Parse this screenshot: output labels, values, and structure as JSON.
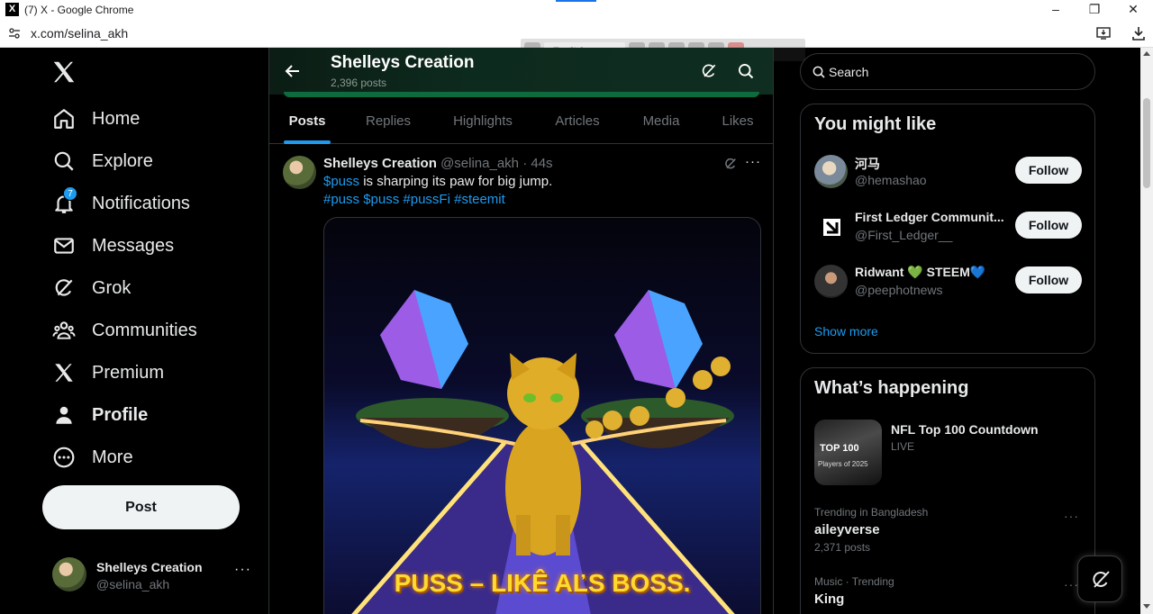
{
  "browser": {
    "window_title": "(7) X - Google Chrome",
    "favicon_letter": "X",
    "url": "x.com/selina_akh",
    "minimize_label": "–",
    "maximize_label": "❐",
    "close_label": "✕"
  },
  "translate_bar": {
    "language": "English"
  },
  "nav": {
    "items": [
      {
        "label": "Home",
        "icon": "home-icon"
      },
      {
        "label": "Explore",
        "icon": "search-icon"
      },
      {
        "label": "Notifications",
        "icon": "bell-icon",
        "badge": "7"
      },
      {
        "label": "Messages",
        "icon": "mail-icon"
      },
      {
        "label": "Grok",
        "icon": "grok-icon"
      },
      {
        "label": "Communities",
        "icon": "people-icon"
      },
      {
        "label": "Premium",
        "icon": "x-logo-icon"
      },
      {
        "label": "Profile",
        "icon": "person-icon"
      },
      {
        "label": "More",
        "icon": "more-circle-icon"
      }
    ],
    "post_button": "Post",
    "account": {
      "name": "Shelleys Creation",
      "handle": "@selina_akh",
      "more": "···"
    }
  },
  "profile_header": {
    "name": "Shelleys Creation",
    "post_count": "2,396 posts"
  },
  "tabs": [
    "Posts",
    "Replies",
    "Highlights",
    "Articles",
    "Media",
    "Likes"
  ],
  "tweet": {
    "author_name": "Shelleys Creation",
    "author_handle": "@selina_akh",
    "separator": "·",
    "time": "44s",
    "more": "···",
    "line1_cashtag": "$puss",
    "line1_text": " is sharping its paw for big jump.",
    "hashtags": [
      "#puss",
      "$puss",
      "#pussFi",
      "#steemit"
    ],
    "image_caption": "PUSS – LIKÊ AĽS BOSS."
  },
  "search": {
    "placeholder": "Search"
  },
  "you_might_like": {
    "title": "You might like",
    "accounts": [
      {
        "name": "河马",
        "handle": "@hemashao",
        "button": "Follow"
      },
      {
        "name": "First Ledger Communit...",
        "handle": "@First_Ledger__",
        "button": "Follow"
      },
      {
        "name": "Ridwant 💚 STEEM💙",
        "handle": "@peephotnews",
        "button": "Follow"
      }
    ],
    "show_more": "Show more"
  },
  "whats_happening": {
    "title": "What’s happening",
    "featured": {
      "title": "NFL Top 100 Countdown",
      "status": "LIVE",
      "image_text": "TOP 100",
      "image_subtext": "Players of 2025"
    },
    "trends": [
      {
        "context": "Trending in Bangladesh",
        "name": "aileyverse",
        "count": "2,371 posts",
        "more": "···"
      },
      {
        "context": "Music · Trending",
        "name": "King",
        "count": "",
        "more": "···"
      }
    ]
  },
  "colors": {
    "accent": "#1d9bf0",
    "background": "#000000",
    "border": "#2f3336",
    "muted_text": "#71767b",
    "button_light": "#eff3f4"
  }
}
